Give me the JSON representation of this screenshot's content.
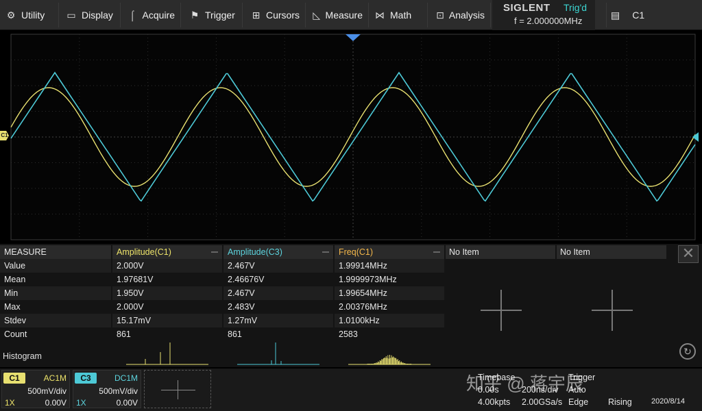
{
  "toolbar": {
    "items": [
      {
        "label": "Utility",
        "icon": "gear-icon"
      },
      {
        "label": "Display",
        "icon": "monitor-icon"
      },
      {
        "label": "Acquire",
        "icon": "acquire-icon"
      },
      {
        "label": "Trigger",
        "icon": "flag-icon"
      },
      {
        "label": "Cursors",
        "icon": "cursor-grid-icon"
      },
      {
        "label": "Measure",
        "icon": "ruler-icon"
      },
      {
        "label": "Math",
        "icon": "math-icon"
      },
      {
        "label": "Analysis",
        "icon": "analysis-icon"
      }
    ]
  },
  "brand": {
    "logo": "SIGLENT",
    "status": "Trig'd",
    "freq": "f = 2.000000MHz"
  },
  "channel_selector": {
    "label": "C1",
    "icon": "file-list-icon"
  },
  "markers": {
    "c1": "C1"
  },
  "colors": {
    "c1": "#e8e070",
    "c3": "#4dc9d6",
    "trigger_marker": "#4a8ee8"
  },
  "measure": {
    "title": "MEASURE",
    "columns": [
      "Amplitude(C1)",
      "Amplitude(C3)",
      "Freq(C1)"
    ],
    "empty_columns": [
      "No Item",
      "No Item"
    ],
    "rows": [
      {
        "label": "Value",
        "values": [
          "2.000V",
          "2.467V",
          "1.99914MHz"
        ]
      },
      {
        "label": "Mean",
        "values": [
          "1.97681V",
          "2.46676V",
          "1.9999973MHz"
        ]
      },
      {
        "label": "Min",
        "values": [
          "1.950V",
          "2.467V",
          "1.99654MHz"
        ]
      },
      {
        "label": "Max",
        "values": [
          "2.000V",
          "2.483V",
          "2.00376MHz"
        ]
      },
      {
        "label": "Stdev",
        "values": [
          "15.17mV",
          "1.27mV",
          "1.0100kHz"
        ]
      },
      {
        "label": "Count",
        "values": [
          "861",
          "861",
          "2583"
        ]
      }
    ],
    "histogram_label": "Histogram"
  },
  "channels": [
    {
      "name": "C1",
      "coupling": "AC1M",
      "vdiv": "500mV/div",
      "probe": "1X",
      "offset": "0.00V"
    },
    {
      "name": "C3",
      "coupling": "DC1M",
      "vdiv": "500mV/div",
      "probe": "1X",
      "offset": "0.00V"
    }
  ],
  "timebase": {
    "label": "Timebase",
    "delay": "0.00s",
    "scale": "200ns/div",
    "points": "4.00kpts",
    "rate": "2.00GSa/s"
  },
  "trigger": {
    "label": "Trigger",
    "mode": "Auto",
    "type": "Edge",
    "slope": "Rising"
  },
  "date": {
    "value": "2020/8/14"
  },
  "watermark": "知乎 @ 蒋宇辰"
}
